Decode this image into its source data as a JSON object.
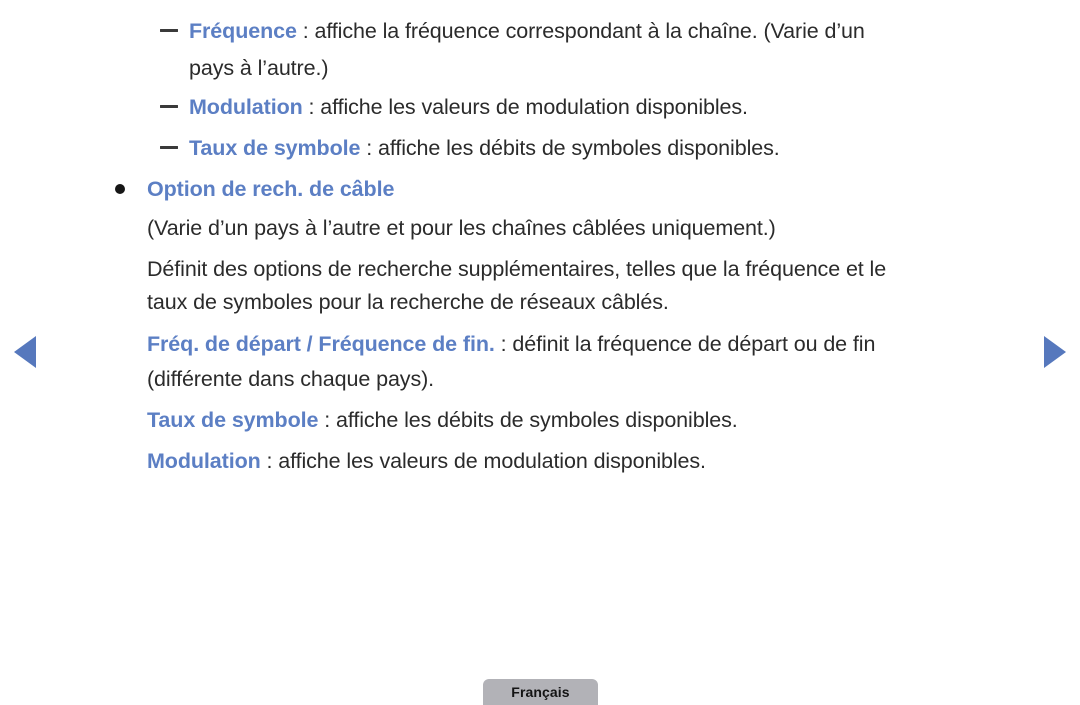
{
  "page": {
    "language_tab": "Français",
    "accent_color": "#5c7fc4",
    "body_text_color": "#2b2b2b",
    "background_color": "#ffffff"
  },
  "navigation": {
    "prev_icon": "triangle-left-icon",
    "next_icon": "triangle-right-icon",
    "prev_label": "",
    "next_label": ""
  },
  "content": {
    "sub_items": [
      {
        "marker": "dash",
        "term": "Fréquence",
        "separator": " : ",
        "text": "affiche la fréquence correspondant à la chaîne. (Varie d’un",
        "continuation": "pays à l’autre.)"
      },
      {
        "marker": "dash",
        "term": "Modulation",
        "separator": " : ",
        "text": "affiche les valeurs de modulation disponibles.",
        "continuation": ""
      },
      {
        "marker": "dash",
        "term": "Taux de symbole",
        "separator": " : ",
        "text": "affiche les débits de symboles disponibles.",
        "continuation": ""
      }
    ],
    "bullet_heading": {
      "marker": "dot",
      "term": "Option de rech. de câble"
    },
    "paragraphs": [
      "(Varie d’un pays à l’autre et pour les chaînes câblées uniquement.)",
      "Définit des options de recherche supplémentaires, telles que la fréquence et le",
      "taux de symboles pour la recherche de réseaux câblés."
    ],
    "detail_items": [
      {
        "term": "Fréq. de départ / Fréquence de fin.",
        "separator": " : ",
        "text": "définit la fréquence de départ ou de fin",
        "continuation": "(différente dans chaque pays)."
      },
      {
        "term": "Taux de symbole",
        "separator": " : ",
        "text": "affiche les débits de symboles disponibles.",
        "continuation": ""
      },
      {
        "term": "Modulation",
        "separator": " : ",
        "text": "affiche les valeurs de modulation disponibles.",
        "continuation": ""
      }
    ]
  }
}
